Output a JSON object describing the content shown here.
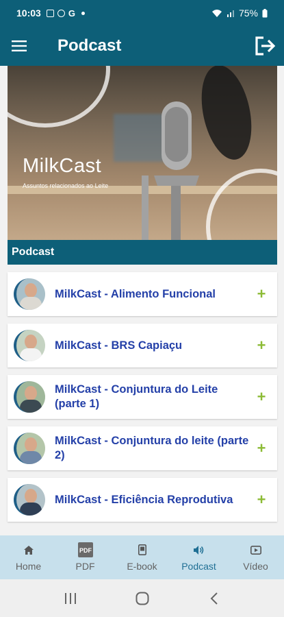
{
  "status_bar": {
    "time": "10:03",
    "notification_icons": [
      "image-icon",
      "circle-app-icon",
      "google-icon"
    ],
    "google_label": "G",
    "battery_percent": "75%"
  },
  "app_bar": {
    "title": "Podcast",
    "menu_icon": "hamburger-menu-icon",
    "logout_icon": "logout-icon"
  },
  "banner": {
    "title": "MilkCast",
    "subtitle": "Assuntos relacionados ao Leite"
  },
  "section": {
    "header": "Podcast"
  },
  "podcasts": [
    {
      "title": "MilkCast - Alimento Funcional",
      "expand": "+"
    },
    {
      "title": "MilkCast - BRS Capiaçu",
      "expand": "+"
    },
    {
      "title": "MilkCast - Conjuntura do Leite (parte 1)",
      "expand": "+"
    },
    {
      "title": "MilkCast - Conjuntura do leite (parte 2)",
      "expand": "+"
    },
    {
      "title": "MilkCast - Eficiência Reprodutiva",
      "expand": "+"
    }
  ],
  "bottom_nav": [
    {
      "label": "Home",
      "icon": "home-icon"
    },
    {
      "label": "PDF",
      "icon": "pdf-icon"
    },
    {
      "label": "E-book",
      "icon": "ebook-icon"
    },
    {
      "label": "Podcast",
      "icon": "speaker-icon",
      "active": true
    },
    {
      "label": "Vídeo",
      "icon": "video-icon"
    }
  ],
  "colors": {
    "primary": "#0d5f78",
    "item_text": "#2440a8",
    "plus": "#8cbb35",
    "nav_bg": "#c7e0ec",
    "nav_active": "#1f6f94"
  }
}
